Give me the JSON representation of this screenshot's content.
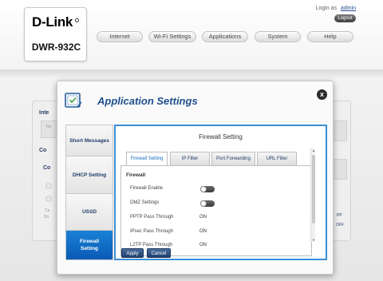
{
  "header": {
    "brand": "D-Link",
    "model": "DWR-932C",
    "login_text": "Login as",
    "login_user": "admin",
    "logout_label": "Logout",
    "nav": [
      "Internet",
      "Wi-Fi Settings",
      "Applications",
      "System",
      "Help"
    ]
  },
  "background": {
    "rows": [
      "Inte",
      "Co",
      "Co"
    ],
    "small": [
      "No",
      "Ca",
      "Str"
    ],
    "right_tags": [
      "PP",
      "OFF"
    ]
  },
  "modal": {
    "title": "Application Settings",
    "close_label": "x",
    "sidebar": [
      {
        "label": "Short Messages",
        "active": false
      },
      {
        "label": "DHCP Setting",
        "active": false
      },
      {
        "label": "USSD",
        "active": false
      },
      {
        "label": "Firewall Setting",
        "active": true
      }
    ],
    "content_title": "Firewall Setting",
    "tabs": [
      "Firewall Setting",
      "IP Filter",
      "Port Forwarding",
      "URL Filter"
    ],
    "active_tab": 0,
    "section_title": "Firewall",
    "fields": [
      {
        "label": "Firewall Enable",
        "type": "toggle",
        "value": "off"
      },
      {
        "label": "DMZ Settings",
        "type": "toggle",
        "value": "off"
      },
      {
        "label": "PPTP Pass Through",
        "type": "text",
        "value": "ON"
      },
      {
        "label": "IPsec Pass Through",
        "type": "text",
        "value": "ON"
      },
      {
        "label": "L2TP Pass Through",
        "type": "text",
        "value": "ON"
      }
    ],
    "apply_label": "Apply",
    "cancel_label": "Cancel"
  },
  "colors": {
    "accent": "#1a6fc2",
    "active_menu": "#0a5ab5",
    "title": "#1f4e8c"
  }
}
